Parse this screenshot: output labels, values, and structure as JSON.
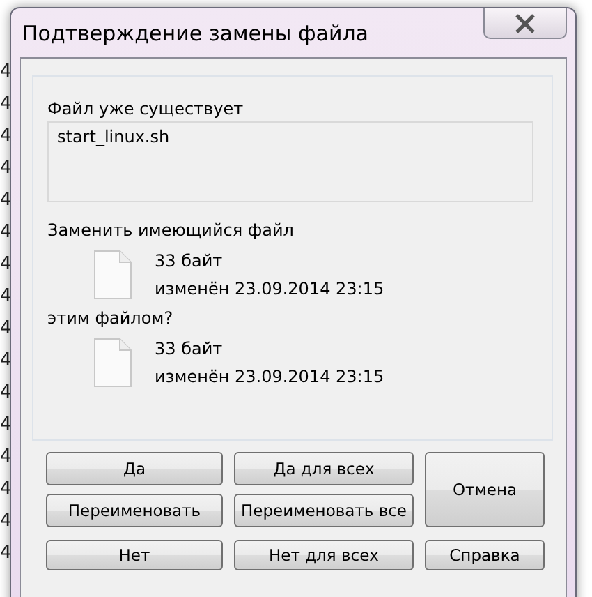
{
  "background": {
    "row_marks": [
      "4",
      "4",
      "4",
      "4",
      "4",
      "4",
      "4",
      "4",
      "4",
      "4",
      "4",
      "4",
      "4",
      "4",
      "4",
      "4"
    ]
  },
  "dialog": {
    "title": "Подтверждение замены файла",
    "exists_label": "Файл уже существует",
    "file_name": "start_linux.sh",
    "replace_label": "Заменить имеющийся файл",
    "existing_file": {
      "size": "33 байт",
      "modified": "изменён 23.09.2014 23:15"
    },
    "with_label": "этим файлом?",
    "new_file": {
      "size": "33 байт",
      "modified": "изменён 23.09.2014 23:15"
    },
    "buttons": [
      {
        "label": "Да",
        "kind": "grid"
      },
      {
        "label": "Да для всех",
        "kind": "grid"
      },
      {
        "label": "Отмена",
        "kind": "tall"
      },
      {
        "label": "Переименовать",
        "kind": "grid"
      },
      {
        "label": "Переименовать все",
        "kind": "grid"
      },
      {
        "label": "Нет",
        "kind": "grid"
      },
      {
        "label": "Нет для всех",
        "kind": "grid"
      },
      {
        "label": "Справка",
        "kind": "grid"
      }
    ]
  }
}
